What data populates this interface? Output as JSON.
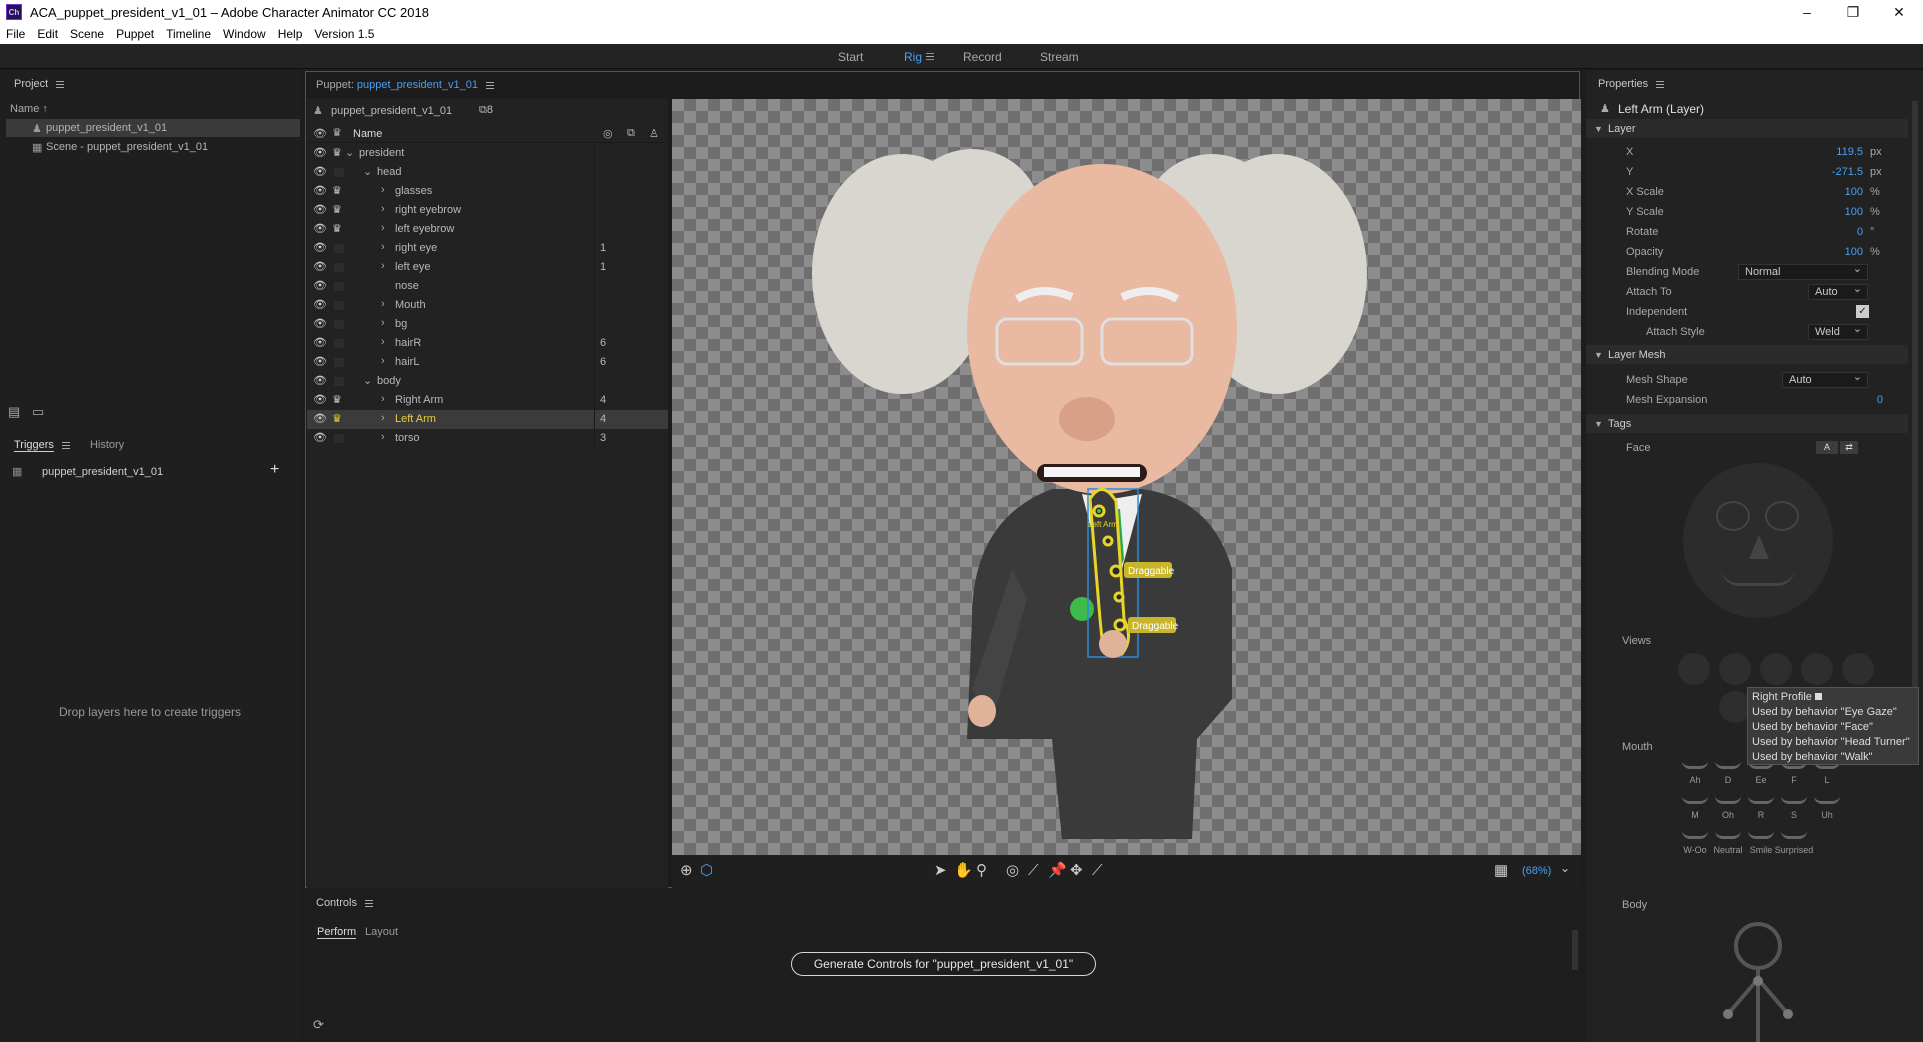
{
  "window": {
    "title": "ACA_puppet_president_v1_01 – Adobe Character Animator CC 2018",
    "app_icon": "Ch"
  },
  "menu": [
    "File",
    "Edit",
    "Scene",
    "Puppet",
    "Timeline",
    "Window",
    "Help",
    "Version 1.5"
  ],
  "workspaces": {
    "start": "Start",
    "rig": "Rig",
    "record": "Record",
    "stream": "Stream"
  },
  "project": {
    "title": "Project",
    "col_name": "Name",
    "items": [
      "puppet_president_v1_01",
      "Scene - puppet_president_v1_01"
    ]
  },
  "triggers": {
    "tab_triggers": "Triggers",
    "tab_history": "History",
    "puppet": "puppet_president_v1_01",
    "drop_hint": "Drop layers here to create triggers"
  },
  "puppet_panel": {
    "label": "Puppet:",
    "puppet_name": "puppet_president_v1_01",
    "header_name": "puppet_president_v1_01",
    "count": "8",
    "col_name": "Name",
    "layers": [
      {
        "name": "president",
        "indent": 0,
        "open": true,
        "crown": true,
        "num": ""
      },
      {
        "name": "head",
        "indent": 1,
        "open": true,
        "crown": false,
        "num": ""
      },
      {
        "name": "glasses",
        "indent": 2,
        "open": false,
        "crown": true,
        "num": ""
      },
      {
        "name": "right eyebrow",
        "indent": 2,
        "open": false,
        "crown": true,
        "num": ""
      },
      {
        "name": "left eyebrow",
        "indent": 2,
        "open": false,
        "crown": true,
        "num": ""
      },
      {
        "name": "right eye",
        "indent": 2,
        "open": false,
        "crown": false,
        "num": "1"
      },
      {
        "name": "left eye",
        "indent": 2,
        "open": false,
        "crown": false,
        "num": "1"
      },
      {
        "name": "nose",
        "indent": 2,
        "open": null,
        "crown": false,
        "num": ""
      },
      {
        "name": "Mouth",
        "indent": 2,
        "open": false,
        "crown": false,
        "num": ""
      },
      {
        "name": "bg",
        "indent": 2,
        "open": false,
        "crown": false,
        "num": ""
      },
      {
        "name": "hairR",
        "indent": 2,
        "open": false,
        "crown": false,
        "num": "6"
      },
      {
        "name": "hairL",
        "indent": 2,
        "open": false,
        "crown": false,
        "num": "6"
      },
      {
        "name": "body",
        "indent": 1,
        "open": true,
        "crown": false,
        "num": ""
      },
      {
        "name": "Right Arm",
        "indent": 2,
        "open": false,
        "crown": true,
        "num": "4"
      },
      {
        "name": "Left Arm",
        "indent": 2,
        "open": false,
        "crown": true,
        "num": "4",
        "selected": true
      },
      {
        "name": "torso",
        "indent": 2,
        "open": false,
        "crown": false,
        "num": "3"
      }
    ],
    "handle_label_top": "Left Arm",
    "draggable_1": "Draggable",
    "draggable_2": "Draggable",
    "zoom": "(68%)"
  },
  "controls": {
    "title": "Controls",
    "tab_perform": "Perform",
    "tab_layout": "Layout",
    "generate_button": "Generate Controls for \"puppet_president_v1_01\""
  },
  "properties": {
    "title": "Properties",
    "layer_title": "Left Arm (Layer)",
    "section_layer": "Layer",
    "x_label": "X",
    "x_value": "119.5",
    "x_unit": "px",
    "y_label": "Y",
    "y_value": "-271.5",
    "y_unit": "px",
    "xscale_label": "X Scale",
    "xscale_value": "100",
    "xscale_unit": "%",
    "yscale_label": "Y Scale",
    "yscale_value": "100",
    "yscale_unit": "%",
    "rotate_label": "Rotate",
    "rotate_value": "0",
    "rotate_unit": "°",
    "opacity_label": "Opacity",
    "opacity_value": "100",
    "opacity_unit": "%",
    "blend_label": "Blending Mode",
    "blend_value": "Normal",
    "attach_label": "Attach To",
    "attach_value": "Auto",
    "independent_label": "Independent",
    "attachstyle_label": "Attach Style",
    "attachstyle_value": "Weld",
    "section_mesh": "Layer Mesh",
    "meshshape_label": "Mesh Shape",
    "meshshape_value": "Auto",
    "meshexp_label": "Mesh Expansion",
    "meshexp_value": "0",
    "section_tags": "Tags",
    "face_label": "Face",
    "views_label": "Views",
    "mouth_label": "Mouth",
    "body_label": "Body",
    "face_btn_a": "A",
    "mouth_shapes": [
      "Ah",
      "D",
      "Ee",
      "F",
      "L",
      "M",
      "Oh",
      "R",
      "S",
      "Uh",
      "W-Oo",
      "Neutral",
      "Smile",
      "Surprised"
    ],
    "tooltip": [
      "Right Profile",
      "Used by behavior \"Eye Gaze\"",
      "Used by behavior \"Face\"",
      "Used by behavior \"Head Turner\"",
      "Used by behavior \"Walk\""
    ]
  },
  "colors": {
    "accent": "#4c9ef0",
    "selected_layer": "#e6cf3a",
    "handle": "#e6d62c"
  }
}
